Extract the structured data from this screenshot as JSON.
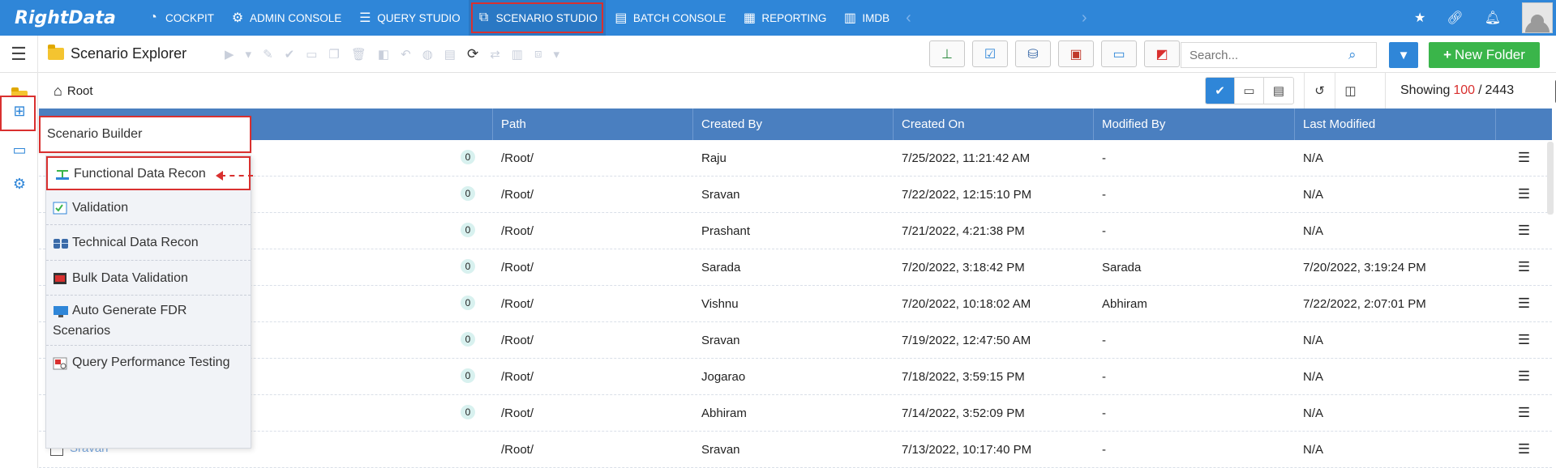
{
  "app": {
    "logo": "RightData"
  },
  "topnav": {
    "items": [
      {
        "label": "COCKPIT",
        "icon": "speedometer-icon"
      },
      {
        "label": "ADMIN CONSOLE",
        "icon": "gear-icon"
      },
      {
        "label": "QUERY STUDIO",
        "icon": "database-icon"
      },
      {
        "label": "SCENARIO STUDIO",
        "icon": "scenario-icon",
        "active": true
      },
      {
        "label": "BATCH CONSOLE",
        "icon": "batch-icon"
      },
      {
        "label": "REPORTING",
        "icon": "report-icon"
      },
      {
        "label": "IMDB",
        "icon": "imdb-icon"
      }
    ]
  },
  "toolbar": {
    "title": "Scenario Explorer",
    "search_placeholder": "Search...",
    "new_folder_label": "New Folder"
  },
  "breadcrumb": {
    "root": "Root"
  },
  "showing": {
    "prefix": "Showing",
    "current": "100",
    "separator": "/",
    "total": "2443"
  },
  "grid": {
    "columns": [
      "Path",
      "Created By",
      "Created On",
      "Modified By",
      "Last Modified"
    ],
    "rows": [
      {
        "count": "0",
        "path": "/Root/",
        "created_by": "Raju",
        "created_on": "7/25/2022, 11:21:42 AM",
        "modified_by": "-",
        "last_modified": "N/A"
      },
      {
        "count": "0",
        "path": "/Root/",
        "created_by": "Sravan",
        "created_on": "7/22/2022, 12:15:10 PM",
        "modified_by": "-",
        "last_modified": "N/A"
      },
      {
        "count": "0",
        "path": "/Root/",
        "created_by": "Prashant",
        "created_on": "7/21/2022, 4:21:38 PM",
        "modified_by": "-",
        "last_modified": "N/A"
      },
      {
        "count": "0",
        "path": "/Root/",
        "created_by": "Sarada",
        "created_on": "7/20/2022, 3:18:42 PM",
        "modified_by": "Sarada",
        "last_modified": "7/20/2022, 3:19:24 PM"
      },
      {
        "count": "0",
        "path": "/Root/",
        "created_by": "Vishnu",
        "created_on": "7/20/2022, 10:18:02 AM",
        "modified_by": "Abhiram",
        "last_modified": "7/22/2022, 2:07:01 PM"
      },
      {
        "count": "0",
        "path": "/Root/",
        "created_by": "Sravan",
        "created_on": "7/19/2022, 12:47:50 AM",
        "modified_by": "-",
        "last_modified": "N/A"
      },
      {
        "count": "0",
        "path": "/Root/",
        "created_by": "Jogarao",
        "created_on": "7/18/2022, 3:59:15 PM",
        "modified_by": "-",
        "last_modified": "N/A"
      },
      {
        "count": "0",
        "path": "/Root/",
        "created_by": "Abhiram",
        "created_on": "7/14/2022, 3:52:09 PM",
        "modified_by": "-",
        "last_modified": "N/A"
      },
      {
        "name": "Sravan",
        "path": "/Root/",
        "created_by": "Sravan",
        "created_on": "7/13/2022, 10:17:40 PM",
        "modified_by": "-",
        "last_modified": "N/A"
      }
    ]
  },
  "flyout": {
    "title": "Scenario Builder",
    "items": [
      {
        "label": "Functional Data Recon"
      },
      {
        "label": "Validation"
      },
      {
        "label": "Technical Data Recon"
      },
      {
        "label": "Bulk Data Validation"
      },
      {
        "label": "Auto Generate FDR Scenarios"
      },
      {
        "label": "Query Performance Testing"
      }
    ]
  }
}
